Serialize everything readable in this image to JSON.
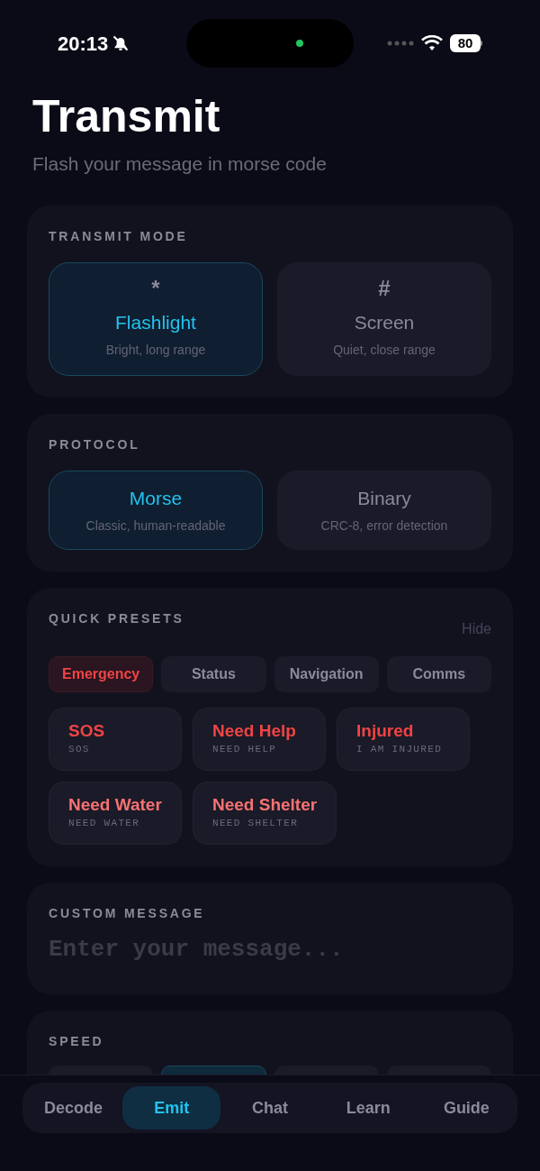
{
  "status_bar": {
    "time": "20:13",
    "battery": "80"
  },
  "header": {
    "title": "Transmit",
    "subtitle": "Flash your message in morse code"
  },
  "transmit_mode": {
    "label": "TRANSMIT MODE",
    "options": [
      {
        "symbol": "*",
        "title": "Flashlight",
        "caption": "Bright, long range",
        "selected": true
      },
      {
        "symbol": "#",
        "title": "Screen",
        "caption": "Quiet, close range",
        "selected": false
      }
    ]
  },
  "protocol": {
    "label": "PROTOCOL",
    "options": [
      {
        "title": "Morse",
        "caption": "Classic, human-readable",
        "selected": true
      },
      {
        "title": "Binary",
        "caption": "CRC-8, error detection",
        "selected": false
      }
    ]
  },
  "quick_presets": {
    "label": "QUICK PRESETS",
    "toggle": "Hide",
    "categories": [
      {
        "label": "Emergency",
        "selected": true
      },
      {
        "label": "Status",
        "selected": false
      },
      {
        "label": "Navigation",
        "selected": false
      },
      {
        "label": "Comms",
        "selected": false
      }
    ],
    "presets": [
      {
        "title": "SOS",
        "code": "SOS",
        "color": "#ef4444"
      },
      {
        "title": "Need Help",
        "code": "NEED HELP",
        "color": "#ef4444"
      },
      {
        "title": "Injured",
        "code": "I AM INJURED",
        "color": "#ef4444"
      },
      {
        "title": "Need Water",
        "code": "NEED WATER",
        "color": "#f87171"
      },
      {
        "title": "Need Shelter",
        "code": "NEED SHELTER",
        "color": "#f87171"
      }
    ]
  },
  "custom_message": {
    "label": "CUSTOM MESSAGE",
    "placeholder": "Enter your message..."
  },
  "speed": {
    "label": "SPEED",
    "options": [
      {
        "selected": false
      },
      {
        "selected": true
      },
      {
        "selected": false
      },
      {
        "selected": false
      }
    ]
  },
  "tab_bar": [
    {
      "label": "Decode",
      "selected": false
    },
    {
      "label": "Emit",
      "selected": true
    },
    {
      "label": "Chat",
      "selected": false
    },
    {
      "label": "Learn",
      "selected": false
    },
    {
      "label": "Guide",
      "selected": false
    }
  ]
}
